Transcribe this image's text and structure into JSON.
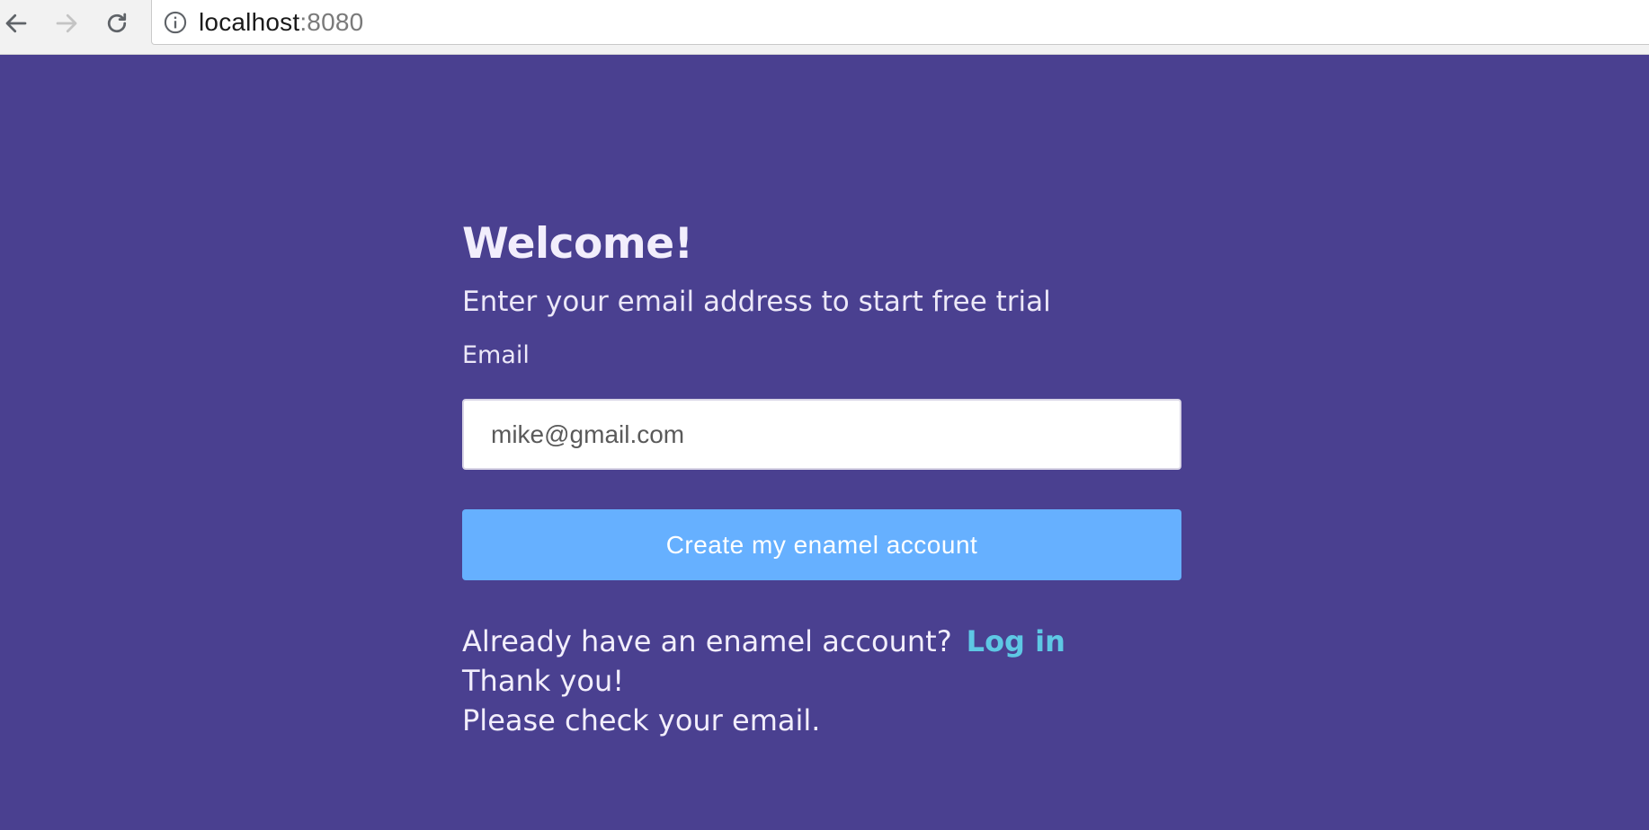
{
  "browser": {
    "url_host": "localhost",
    "url_port": ":8080",
    "icons": {
      "back": "arrow-left-icon",
      "forward": "arrow-right-icon",
      "reload": "reload-icon",
      "info": "info-icon"
    }
  },
  "page": {
    "title": "Welcome!",
    "subtitle": "Enter your email address to start free trial",
    "email_label": "Email",
    "email_value": "mike@gmail.com",
    "create_button_label": "Create my enamel account",
    "login_prompt": "Already have an enamel account?",
    "login_link": "Log in",
    "thank_you": "Thank you!",
    "check_email": "Please check your email."
  },
  "colors": {
    "background": "#4a4090",
    "button": "#66b0ff",
    "link": "#5ec8e4",
    "text": "#f2eefc"
  }
}
